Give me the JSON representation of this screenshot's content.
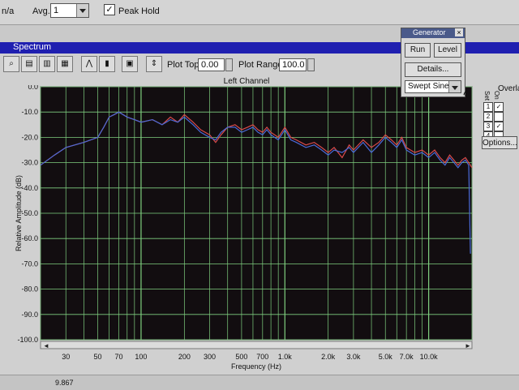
{
  "topbar": {
    "left_text": "n/a",
    "avg_label": "Avg.",
    "avg_value": "1",
    "peak_hold_label": "Peak Hold"
  },
  "window": {
    "title": "Spectrum"
  },
  "toolbar": {
    "plot_top_label": "Plot Top:",
    "plot_top_value": "0.00",
    "plot_range_label": "Plot Range:",
    "plot_range_value": "100.0"
  },
  "plot": {
    "channel_title": "Left Channel"
  },
  "generator": {
    "title": "Generator",
    "run": "Run",
    "level": "Level",
    "details": "Details...",
    "waveform": "Swept Sine"
  },
  "overlays": {
    "title": "Overla",
    "set_label": "Set",
    "on_label": "On",
    "rows": [
      "1",
      "2",
      "3",
      "4"
    ],
    "options": "Options..."
  },
  "bottom": {
    "value": "9.867"
  },
  "chart_data": {
    "type": "line",
    "title": "Left Channel",
    "xlabel": "Frequency (Hz)",
    "ylabel": "Relative Amplitude (dB)",
    "x_scale": "log",
    "xlim": [
      20,
      20000
    ],
    "ylim": [
      -100,
      0
    ],
    "x_tick_labels": [
      "30",
      "50",
      "70",
      "100",
      "200",
      "300",
      "500",
      "700",
      "1.0k",
      "2.0k",
      "3.0k",
      "5.0k",
      "7.0k",
      "10.0k"
    ],
    "x_ticks": [
      30,
      50,
      70,
      100,
      200,
      300,
      500,
      700,
      1000,
      2000,
      3000,
      5000,
      7000,
      10000
    ],
    "y_ticks": [
      0,
      -10,
      -20,
      -30,
      -40,
      -50,
      -60,
      -70,
      -80,
      -90,
      -100
    ],
    "y_tick_labels": [
      "0.0",
      "-10.0",
      "-20.0",
      "-30.0",
      "-40.0",
      "-50.0",
      "-60.0",
      "-70.0",
      "-80.0",
      "-90.0",
      "-100.0"
    ],
    "grid": true,
    "series": [
      {
        "color": "#d84a4a",
        "x": [
          20,
          25,
          30,
          40,
          50,
          55,
          60,
          65,
          70,
          80,
          90,
          100,
          120,
          140,
          160,
          180,
          200,
          230,
          260,
          300,
          330,
          360,
          400,
          450,
          500,
          550,
          600,
          650,
          700,
          750,
          800,
          900,
          1000,
          1100,
          1200,
          1400,
          1600,
          1800,
          2000,
          2200,
          2500,
          2800,
          3000,
          3500,
          4000,
          4500,
          5000,
          5500,
          6000,
          6500,
          7000,
          8000,
          9000,
          10000,
          11000,
          12000,
          13000,
          14000,
          15000,
          16000,
          17000,
          18000,
          19000,
          20000
        ],
        "y": [
          -31,
          -27,
          -24,
          -22,
          -20,
          -16,
          -12,
          -11,
          -10,
          -12,
          -13,
          -14,
          -13,
          -15,
          -12,
          -14,
          -11,
          -14,
          -17,
          -19,
          -22,
          -19,
          -16,
          -15,
          -17,
          -16,
          -15,
          -17,
          -18,
          -16,
          -18,
          -20,
          -16,
          -20,
          -21,
          -23,
          -22,
          -24,
          -26,
          -24,
          -28,
          -23,
          -25,
          -21,
          -24,
          -22,
          -19,
          -21,
          -23,
          -20,
          -24,
          -26,
          -25,
          -27,
          -25,
          -28,
          -30,
          -27,
          -29,
          -31,
          -29,
          -28,
          -30,
          -32
        ]
      },
      {
        "color": "#4a6ad8",
        "x": [
          20,
          25,
          30,
          40,
          50,
          55,
          60,
          65,
          70,
          80,
          90,
          100,
          120,
          140,
          160,
          180,
          200,
          230,
          260,
          300,
          330,
          360,
          400,
          450,
          500,
          550,
          600,
          650,
          700,
          750,
          800,
          900,
          1000,
          1100,
          1200,
          1400,
          1600,
          1800,
          2000,
          2200,
          2500,
          2800,
          3000,
          3500,
          4000,
          4500,
          5000,
          5500,
          6000,
          6500,
          7000,
          8000,
          9000,
          10000,
          11000,
          12000,
          13000,
          14000,
          15000,
          16000,
          17000,
          18000,
          19000,
          19500
        ],
        "y": [
          -31,
          -27,
          -24,
          -22,
          -20,
          -16,
          -12,
          -11,
          -10,
          -12,
          -13,
          -14,
          -13,
          -15,
          -13,
          -14,
          -12,
          -15,
          -18,
          -20,
          -21,
          -18,
          -16,
          -16,
          -18,
          -17,
          -16,
          -18,
          -19,
          -17,
          -19,
          -21,
          -17,
          -21,
          -22,
          -24,
          -23,
          -25,
          -27,
          -25,
          -26,
          -24,
          -26,
          -22,
          -26,
          -23,
          -20,
          -22,
          -24,
          -21,
          -25,
          -27,
          -26,
          -28,
          -26,
          -29,
          -31,
          -28,
          -30,
          -32,
          -30,
          -29,
          -31,
          -66
        ]
      }
    ]
  }
}
